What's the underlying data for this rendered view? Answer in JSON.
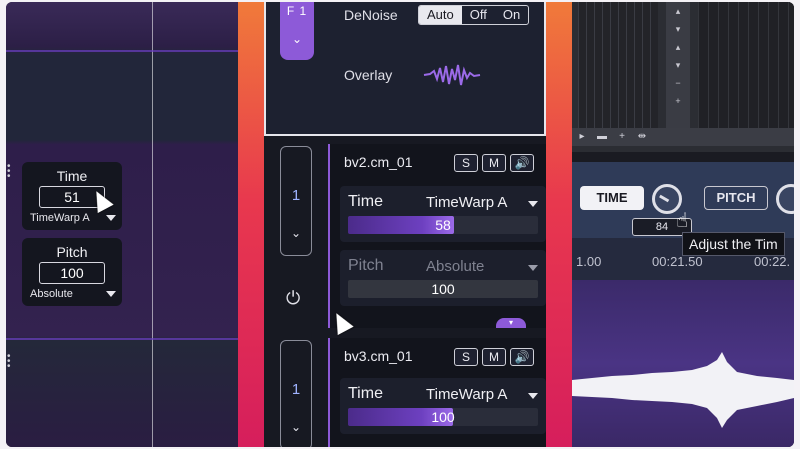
{
  "left_panel": {
    "time": {
      "label": "Time",
      "value": "51",
      "mode": "TimeWarp A"
    },
    "pitch": {
      "label": "Pitch",
      "value": "100",
      "mode": "Absolute"
    }
  },
  "top_box": {
    "tab_label": "F 1",
    "denoise": {
      "label": "DeNoise",
      "options": [
        "Auto",
        "Off",
        "On"
      ],
      "selected": "Auto"
    },
    "overlay_label": "Overlay"
  },
  "tracks": [
    {
      "name": "bv2.cm_01",
      "number": "1",
      "buttons": {
        "solo": "S",
        "mute": "M"
      },
      "time": {
        "label": "Time",
        "mode": "TimeWarp A",
        "value": "58",
        "fill": 0.5
      },
      "pitch": {
        "label": "Pitch",
        "mode": "Absolute",
        "value": "100"
      }
    },
    {
      "name": "bv3.cm_01",
      "number": "1",
      "buttons": {
        "solo": "S",
        "mute": "M"
      },
      "time": {
        "label": "Time",
        "mode": "TimeWarp A",
        "value": "100",
        "fill": 0.55
      }
    }
  ],
  "right_panel": {
    "time_button": "TIME",
    "knob_value": "84",
    "pitch_button": "PITCH",
    "tooltip": "Adjust the Tim",
    "ruler": [
      "1.00",
      "00:21.50",
      "00:22."
    ]
  },
  "colors": {
    "accent_purple": "#8d5ad8",
    "orange_bar": "#e8384e",
    "fill_purple": "#6d40c0"
  }
}
